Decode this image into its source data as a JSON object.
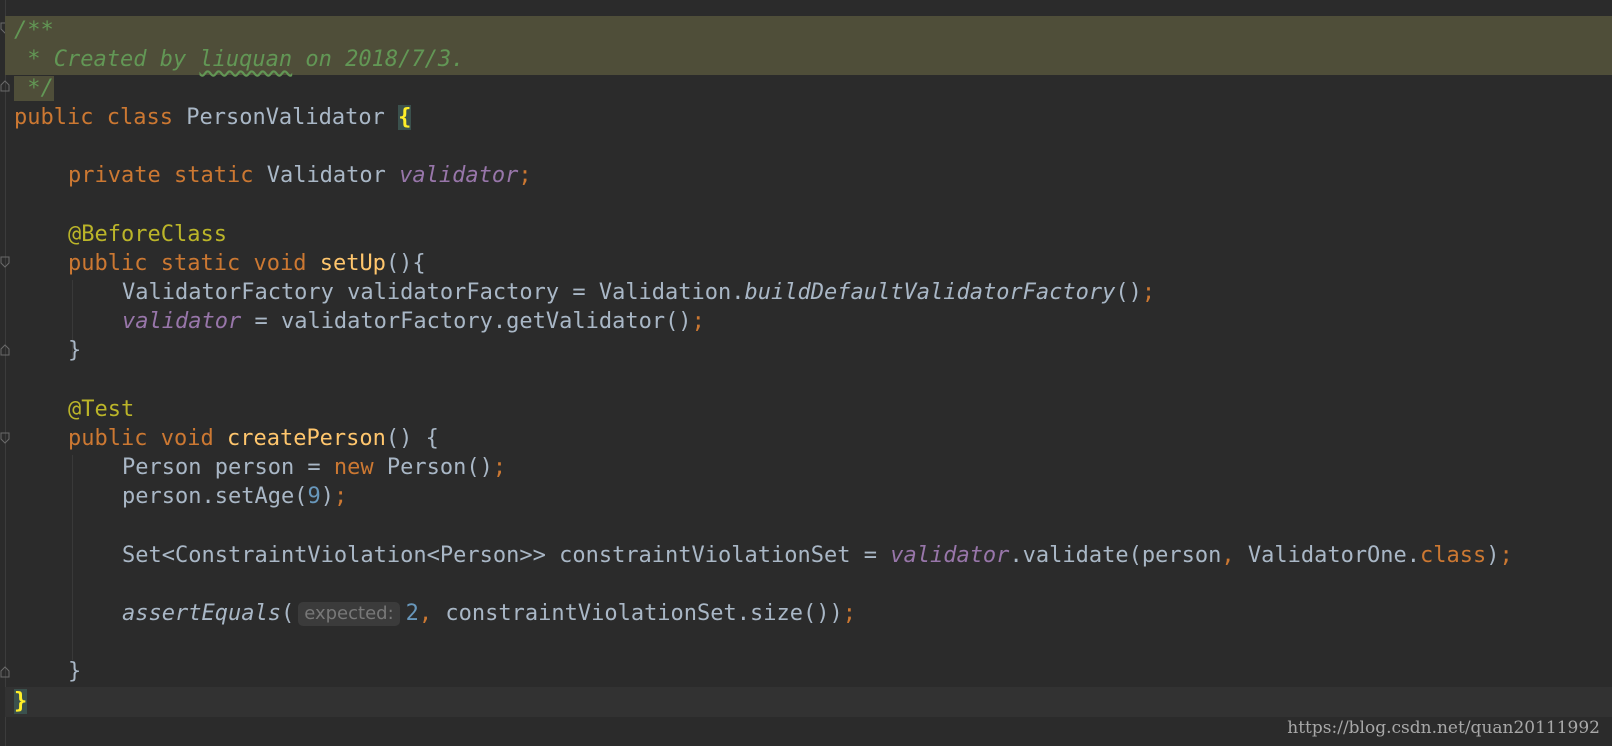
{
  "code": {
    "comment_line1": "/**",
    "comment_line2_prefix": " * Created by ",
    "comment_author": "liuquan",
    "comment_line2_suffix": " on 2018/7/3.",
    "comment_line3": " */",
    "class_kw_public": "public",
    "class_kw_class": "class",
    "class_name": "PersonValidator",
    "open_brace": "{",
    "field_private": "private",
    "field_static": "static",
    "field_type": "Validator",
    "field_name": "validator",
    "semicolon": ";",
    "annotation_before": "@BeforeClass",
    "m1_public": "public",
    "m1_static": "static",
    "m1_void": "void",
    "m1_name": "setUp",
    "m1_sig": "(){",
    "s1_type": "ValidatorFactory validatorFactory = Validation.",
    "s1_call": "buildDefaultValidatorFactory",
    "s1_end": "()",
    "s2_field": "validator",
    "s2_rest": " = validatorFactory.getValidator()",
    "close_brace": "}",
    "annotation_test": "@Test",
    "m2_public": "public",
    "m2_void": "void",
    "m2_name": "createPerson",
    "m2_sig": "() {",
    "s3_a": "Person person = ",
    "s3_new": "new",
    "s3_b": " Person()",
    "s4_a": "person.setAge(",
    "s4_num": "9",
    "s4_b": ")",
    "s5_a": "Set<ConstraintViolation<Person>> constraintViolationSet = ",
    "s5_field": "validator",
    "s5_b": ".validate(person",
    "comma": ",",
    "s5_c": " ValidatorOne.",
    "s5_class": "class",
    "s5_d": ")",
    "s6_call": "assertEquals",
    "s6_paren": "(",
    "s6_hint": "expected:",
    "s6_num": "2",
    "s6_rest": " constraintViolationSet.size())",
    "final_brace": "}"
  },
  "watermark": "https://blog.csdn.net/quan20111992",
  "colors": {
    "background": "#2b2b2b",
    "keyword": "#cc7832",
    "comment": "#629755",
    "annotation": "#bbb529",
    "method": "#ffc66d",
    "field": "#9876aa",
    "number": "#6897bb",
    "text": "#a9b7c6",
    "comment_highlight": "#4f4e39"
  }
}
